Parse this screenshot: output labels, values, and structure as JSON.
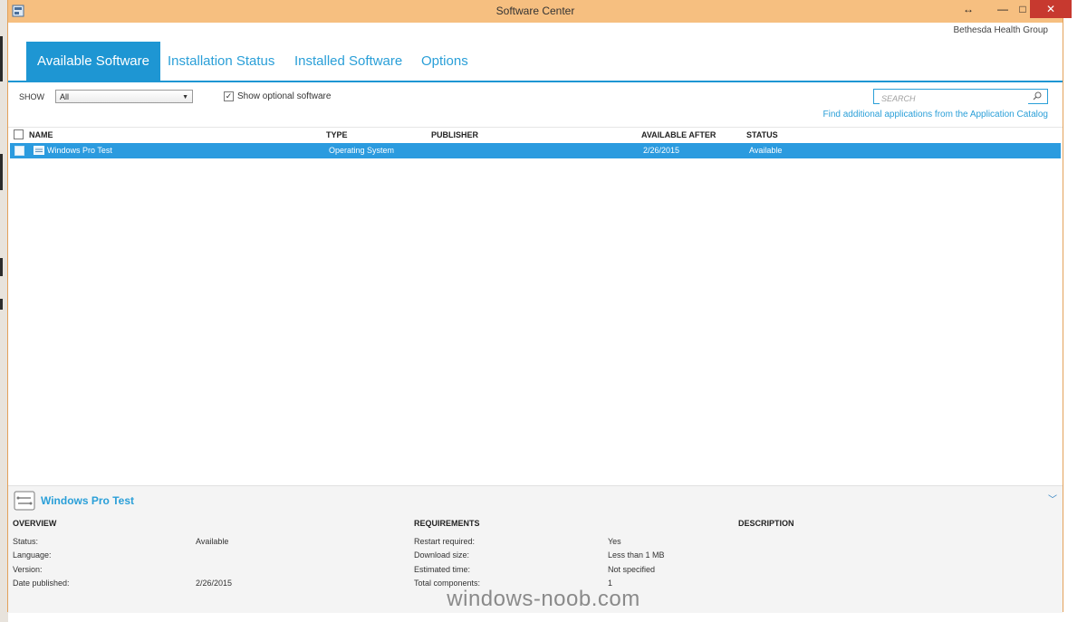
{
  "window": {
    "title": "Software Center",
    "controls": {
      "resize": "↔",
      "minimize": "—",
      "maximize": "□",
      "close": "✕"
    }
  },
  "org_name": "Bethesda Health Group",
  "tabs": [
    {
      "label": "Available Software",
      "active": true
    },
    {
      "label": "Installation Status"
    },
    {
      "label": "Installed Software"
    },
    {
      "label": "Options"
    }
  ],
  "filter": {
    "show_label": "SHOW",
    "show_value": "All",
    "optional_label": "Show optional software",
    "optional_checked": true
  },
  "search": {
    "placeholder": "SEARCH"
  },
  "catalog_link": "Find additional applications from the Application Catalog",
  "columns": {
    "name": "NAME",
    "type": "TYPE",
    "publisher": "PUBLISHER",
    "available_after": "AVAILABLE AFTER",
    "status": "STATUS"
  },
  "rows": [
    {
      "name": "Windows Pro Test",
      "type": "Operating System",
      "publisher": "",
      "available_after": "2/26/2015",
      "status": "Available"
    }
  ],
  "details": {
    "title": "Windows Pro Test",
    "overview": {
      "heading": "OVERVIEW",
      "status_label": "Status:",
      "status_value": "Available",
      "language_label": "Language:",
      "language_value": "",
      "version_label": "Version:",
      "version_value": "",
      "date_label": "Date published:",
      "date_value": "2/26/2015"
    },
    "requirements": {
      "heading": "REQUIREMENTS",
      "restart_label": "Restart required:",
      "restart_value": "Yes",
      "download_label": "Download size:",
      "download_value": "Less than 1 MB",
      "time_label": "Estimated time:",
      "time_value": "Not specified",
      "components_label": "Total components:",
      "components_value": "1"
    },
    "description": {
      "heading": "DESCRIPTION"
    }
  },
  "watermark": "windows-noob.com",
  "colors": {
    "accent": "#1e96d3",
    "titlebar": "#f6bf80",
    "selection": "#2b9bdf",
    "close": "#c7392f"
  }
}
